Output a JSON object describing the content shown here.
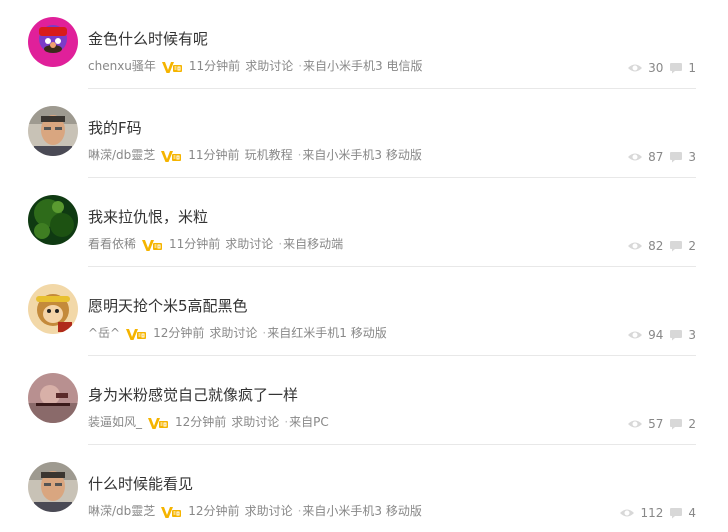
{
  "posts": [
    {
      "title": "金色什么时候有呢",
      "user": "chenxu骚年",
      "time": "11分钟前",
      "category": "求助讨论",
      "source": "来自小米手机3 电信版",
      "views": "30",
      "comments": "1",
      "avatar": "avatar-cartoon"
    },
    {
      "title": "我的F码",
      "user": "啉溁/db靈芝",
      "time": "11分钟前",
      "category": "玩机教程",
      "source": "来自小米手机3 移动版",
      "views": "87",
      "comments": "3",
      "avatar": "avatar-man"
    },
    {
      "title": "我来拉仇恨，米粒",
      "user": "看看依稀",
      "time": "11分钟前",
      "category": "求助讨论",
      "source": "来自移动端",
      "views": "82",
      "comments": "2",
      "avatar": "avatar-green"
    },
    {
      "title": "愿明天抢个米5高配黑色",
      "user": "^岳^",
      "time": "12分钟前",
      "category": "求助讨论",
      "source": "来自红米手机1 移动版",
      "views": "94",
      "comments": "3",
      "avatar": "avatar-monkey"
    },
    {
      "title": "身为米粉感觉自己就像疯了一样",
      "user": "装逼如风_",
      "time": "12分钟前",
      "category": "求助讨论",
      "source": "来自PC",
      "views": "57",
      "comments": "2",
      "avatar": "avatar-pink"
    },
    {
      "title": "什么时候能看见",
      "user": "啉溁/db靈芝",
      "time": "12分钟前",
      "category": "求助讨论",
      "source": "来自小米手机3 移动版",
      "views": "112",
      "comments": "4",
      "avatar": "avatar-man"
    }
  ],
  "colors": {
    "badge": "#f5b400",
    "text": "#333333",
    "meta": "#888888",
    "separator": "#e8e8e8"
  },
  "icons": {
    "views": "eye-icon",
    "comments": "comment-icon",
    "badge": "vip-badge-icon"
  }
}
